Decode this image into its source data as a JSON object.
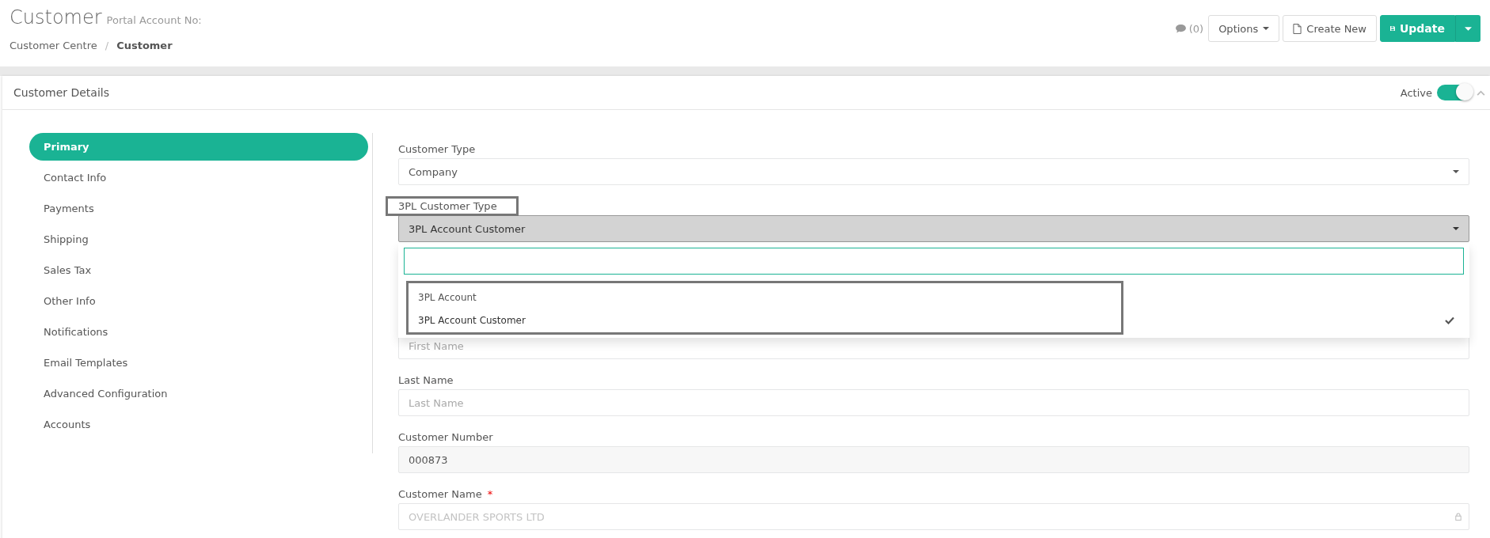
{
  "header": {
    "title": "Customer",
    "subtitle": "Portal Account No:",
    "breadcrumbs": [
      {
        "label": "Customer Centre",
        "current": false
      },
      {
        "label": "Customer",
        "current": true
      }
    ],
    "separator": "/",
    "comments": "(0)",
    "buttons": [
      {
        "label": "Options",
        "kind": "dropdown"
      },
      {
        "label": "Create New",
        "kind": "new"
      },
      {
        "label": "Update",
        "kind": "split"
      }
    ]
  },
  "card": {
    "title": "Customer Details",
    "active_label": "Active",
    "active": true,
    "expanded": true
  },
  "sidebar": {
    "items": [
      {
        "label": "Primary",
        "selected": true
      },
      {
        "label": "Contact Info",
        "selected": false
      },
      {
        "label": "Payments",
        "selected": false
      },
      {
        "label": "Shipping",
        "selected": false
      },
      {
        "label": "Sales Tax",
        "selected": false
      },
      {
        "label": "Other Info",
        "selected": false
      },
      {
        "label": "Notifications",
        "selected": false
      },
      {
        "label": "Email Templates",
        "selected": false
      },
      {
        "label": "Advanced Configuration",
        "selected": false
      },
      {
        "label": "Accounts",
        "selected": false
      }
    ]
  },
  "form": {
    "fields": [
      {
        "kind": "select",
        "label": "Customer Type",
        "value": "Company",
        "highlighted": false
      },
      {
        "kind": "open-select",
        "label": "3PL Customer Type",
        "value": "3PL Account Customer",
        "highlighted": true,
        "options_highlighted": true,
        "options": [
          {
            "label": "3PL Account",
            "selected": false
          },
          {
            "label": "3PL Account Customer",
            "selected": true
          }
        ]
      },
      {
        "kind": "input",
        "placeholder": "First Name"
      },
      {
        "kind": "input",
        "label": "Last Name",
        "placeholder": "Last Name",
        "highlighted": false
      },
      {
        "kind": "readonly",
        "label": "Customer Number",
        "value": "000873",
        "highlighted": false
      },
      {
        "kind": "locked",
        "label": "Customer Name",
        "required_mark": "*",
        "placeholder": "OVERLANDER SPORTS LTD",
        "highlighted": false
      }
    ]
  }
}
